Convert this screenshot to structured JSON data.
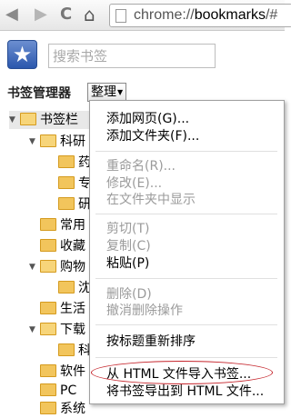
{
  "browser": {
    "back_glyph": "◀",
    "forward_glyph": "▶",
    "reload_glyph": "C",
    "home_glyph": "⌂",
    "url_scheme": "chrome://",
    "url_host": "bookmarks",
    "url_rest": "/#"
  },
  "header": {
    "search_placeholder": "搜索书签",
    "title": "书签管理器",
    "organize_label": "整理"
  },
  "tree": [
    {
      "label": "书签栏",
      "expanded": true
    },
    {
      "label": "科研",
      "expanded": true
    },
    {
      "label": "药"
    },
    {
      "label": "专"
    },
    {
      "label": "研"
    },
    {
      "label": "常用"
    },
    {
      "label": "收藏"
    },
    {
      "label": "购物",
      "expanded": true
    },
    {
      "label": "沈"
    },
    {
      "label": "生活"
    },
    {
      "label": "下载",
      "expanded": true
    },
    {
      "label": "科"
    },
    {
      "label": "软件"
    },
    {
      "label": "PC"
    },
    {
      "label": "系统"
    }
  ],
  "menu": {
    "add_page": "添加网页(G)...",
    "add_folder": "添加文件夹(F)...",
    "rename": "重命名(R)...",
    "edit": "修改(E)...",
    "show_in_folder": "在文件夹中显示",
    "cut": "剪切(T)",
    "copy": "复制(C)",
    "paste": "粘贴(P)",
    "delete": "删除(D)",
    "undo_delete": "撤消删除操作",
    "reorder": "按标题重新排序",
    "import_html": "从 HTML 文件导入书签...",
    "export_html": "将书签导出到 HTML 文件..."
  },
  "colors": {
    "highlight_ellipse": "#c5242b",
    "folder": "#f2c55c"
  }
}
